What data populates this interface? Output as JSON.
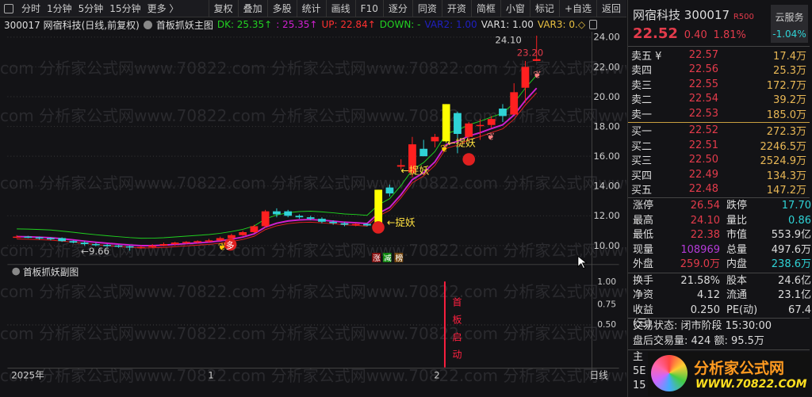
{
  "toolbar": {
    "items": [
      "分时",
      "1分钟",
      "5分钟",
      "15分钟",
      "更多 〉"
    ],
    "buttons": [
      "复权",
      "叠加",
      "多股",
      "统计",
      "画线",
      "F10",
      "逐分",
      "同资",
      "开资",
      "简框",
      "小窗",
      "标记",
      "+自选",
      "返回"
    ]
  },
  "legend": {
    "title": "300017 网宿科技(日线,前复权)",
    "indicator": "首板抓妖主图",
    "dk": "DK: 25.35↑",
    "mid": ": 25.35↑",
    "up": "UP: 22.84↑",
    "down": "DOWN: -",
    "var2": "VAR2: 1.00",
    "var1": "VAR1: 1.00",
    "var3": "VAR3: 0.◇"
  },
  "watermark": "com 分析家公式网www.70822.com 分析家公式网www.70822.com 分析家公式网www.70822.com 分析家公式",
  "chart_data": {
    "type": "candlestick",
    "price_axis": [
      "24.00",
      "22.00",
      "20.00",
      "18.00",
      "16.00",
      "14.00",
      "12.00",
      "10.00"
    ],
    "ylim": [
      9,
      25
    ],
    "candles": [
      [
        10.6,
        10.7,
        10.5,
        10.6
      ],
      [
        10.6,
        10.65,
        10.5,
        10.55
      ],
      [
        10.55,
        10.6,
        10.4,
        10.5
      ],
      [
        10.5,
        10.55,
        10.35,
        10.45
      ],
      [
        10.5,
        10.55,
        10.25,
        10.3
      ],
      [
        10.3,
        10.35,
        10.15,
        10.2
      ],
      [
        10.2,
        10.3,
        10.0,
        10.1
      ],
      [
        10.1,
        10.2,
        9.95,
        10.05
      ],
      [
        10.05,
        10.1,
        9.9,
        10.0
      ],
      [
        10.0,
        10.05,
        9.85,
        9.95
      ],
      [
        9.95,
        10.0,
        9.66,
        9.9
      ],
      [
        9.9,
        10.0,
        9.8,
        9.9
      ],
      [
        9.9,
        10.1,
        9.85,
        10.0
      ],
      [
        10.0,
        10.2,
        9.95,
        10.1
      ],
      [
        10.1,
        10.25,
        10.0,
        10.2
      ],
      [
        10.2,
        10.3,
        10.1,
        10.25
      ],
      [
        10.25,
        10.35,
        10.15,
        10.3
      ],
      [
        10.3,
        10.45,
        10.2,
        10.35
      ],
      [
        10.35,
        10.6,
        10.3,
        10.5
      ],
      [
        10.5,
        10.8,
        10.45,
        10.7
      ],
      [
        10.7,
        11.0,
        10.65,
        10.9
      ],
      [
        10.9,
        11.4,
        10.85,
        11.3
      ],
      [
        11.3,
        12.4,
        11.2,
        12.3
      ],
      [
        12.3,
        12.5,
        11.9,
        12.1
      ],
      [
        12.3,
        12.4,
        11.9,
        12.0
      ],
      [
        12.0,
        12.1,
        11.8,
        11.9
      ],
      [
        11.9,
        12.0,
        11.7,
        11.8
      ],
      [
        11.8,
        11.9,
        11.5,
        11.6
      ],
      [
        11.6,
        11.7,
        11.4,
        11.5
      ],
      [
        11.5,
        11.6,
        11.3,
        11.4
      ],
      [
        11.4,
        11.5,
        11.3,
        11.45
      ],
      [
        11.45,
        11.5,
        11.3,
        11.35
      ],
      [
        11.35,
        13.75,
        11.3,
        13.75
      ],
      [
        13.9,
        14.1,
        13.3,
        13.5
      ],
      [
        15.3,
        15.8,
        15.1,
        15.4
      ],
      [
        14.9,
        17.3,
        14.6,
        16.8
      ],
      [
        16.5,
        17.1,
        16.0,
        16.0
      ],
      [
        17.0,
        17.5,
        16.6,
        17.3
      ],
      [
        17.0,
        19.5,
        16.9,
        19.5
      ],
      [
        18.9,
        19.0,
        16.2,
        17.5
      ],
      [
        17.3,
        18.3,
        17.0,
        18.2
      ],
      [
        18.1,
        18.5,
        17.1,
        18.1
      ],
      [
        18.1,
        18.7,
        17.9,
        18.5
      ],
      [
        19.2,
        19.5,
        18.3,
        18.7
      ],
      [
        18.8,
        20.9,
        18.8,
        20.3
      ],
      [
        20.6,
        22.4,
        19.6,
        22.0
      ],
      [
        22.4,
        24.1,
        22.38,
        22.52
      ]
    ],
    "special_yellow": [
      32,
      38
    ],
    "labels": {
      "high": "24.10",
      "ma_label": "23.20",
      "low": "9.66",
      "zhuoyao": "←捉妖",
      "duo": "多",
      "zhangjianbang": [
        "涨",
        "减",
        "榜"
      ]
    }
  },
  "sub": {
    "title": "首板抓妖副图",
    "axis": [
      "1.00",
      "0.75",
      "0.50"
    ],
    "signal": "首板启动"
  },
  "time_axis": {
    "labels": [
      "2025年",
      "1",
      "2"
    ],
    "period": "日线"
  },
  "quote": {
    "name": "网宿科技",
    "code": "300017",
    "badge": "R500",
    "price": "22.52",
    "change": "0.40",
    "pct": "1.81%",
    "cloud": "云服务",
    "cloud_pct": "-1.04%",
    "sell": [
      [
        "卖五 ¥",
        "22.57",
        "17.4万"
      ],
      [
        "卖四",
        "22.56",
        "25.3万"
      ],
      [
        "卖三",
        "22.55",
        "172.7万"
      ],
      [
        "卖二",
        "22.54",
        "39.2万"
      ],
      [
        "卖一",
        "22.53",
        "185.0万"
      ]
    ],
    "buy": [
      [
        "买一",
        "22.52",
        "272.3万"
      ],
      [
        "买二",
        "22.51",
        "2246.5万"
      ],
      [
        "买三",
        "22.50",
        "2524.9万"
      ],
      [
        "买四",
        "22.49",
        "134.3万"
      ],
      [
        "买五",
        "22.48",
        "147.2万"
      ]
    ],
    "stats1": [
      [
        "涨停",
        "26.54",
        "跌停",
        "17.70"
      ],
      [
        "最高",
        "24.10",
        "量比",
        "0.86"
      ],
      [
        "最低",
        "22.38",
        "市值",
        "553.9亿"
      ],
      [
        "现量",
        "108969",
        "总量",
        "497.6万"
      ],
      [
        "外盘",
        "259.0万",
        "内盘",
        "238.6万"
      ]
    ],
    "stats2": [
      [
        "换手",
        "21.58%",
        "股本",
        "24.6亿"
      ],
      [
        "净资",
        "4.12",
        "流通",
        "23.1亿"
      ],
      [
        "收益(三)",
        "0.250",
        "PE(动)",
        "67.4"
      ]
    ],
    "status": "交易状态: 闭市阶段 15:30:00",
    "after": "盘后交易量: 424  额: 95.5万",
    "rest": [
      "主",
      "5E",
      "15"
    ]
  },
  "logo": {
    "title": "分析家公式网",
    "url": "WWW.70822.COM"
  },
  "colors": {
    "up": "#ff2020",
    "down": "#2fd3d6",
    "yellow": "#ffff00",
    "ma": "#d020d0",
    "band": "#20d020"
  }
}
